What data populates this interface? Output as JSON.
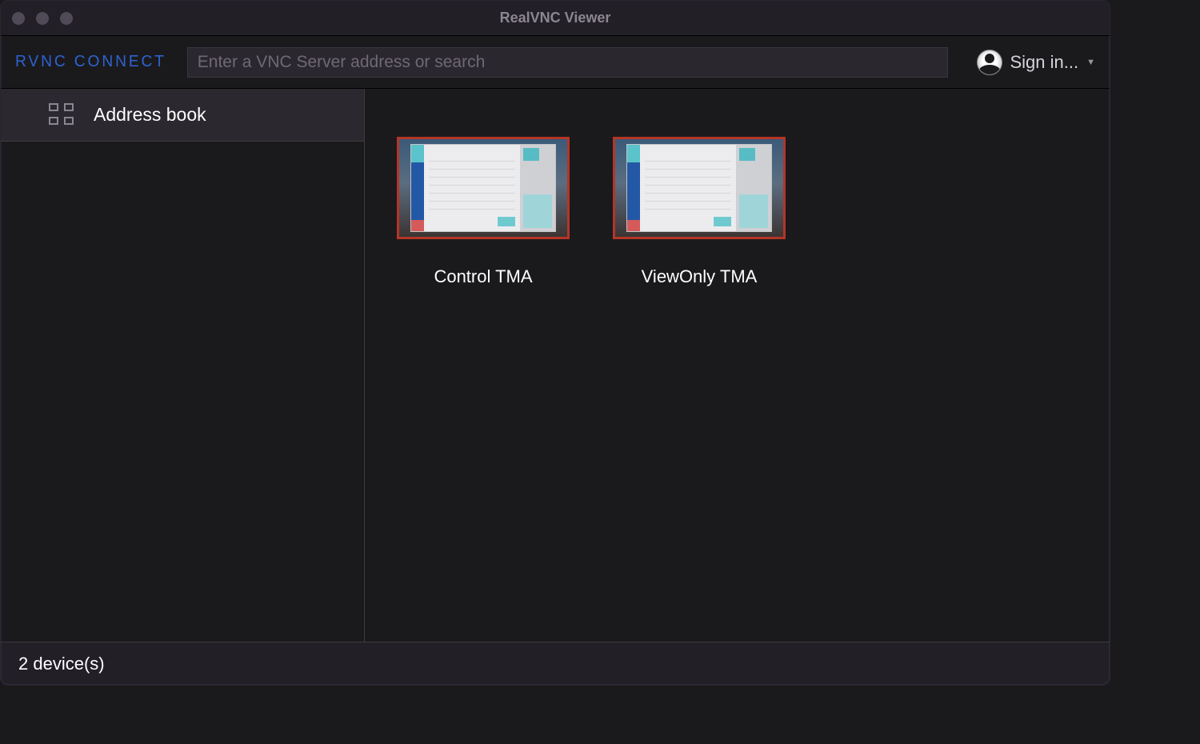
{
  "titlebar": {
    "title": "RealVNC Viewer"
  },
  "toolbar": {
    "logo_text": "RVNC CONNECT",
    "search_placeholder": "Enter a VNC Server address or search",
    "signin_label": "Sign in..."
  },
  "sidebar": {
    "items": [
      {
        "label": "Address book"
      }
    ]
  },
  "devices": [
    {
      "label": "Control TMA"
    },
    {
      "label": "ViewOnly TMA"
    }
  ],
  "statusbar": {
    "text": "2 device(s)"
  }
}
